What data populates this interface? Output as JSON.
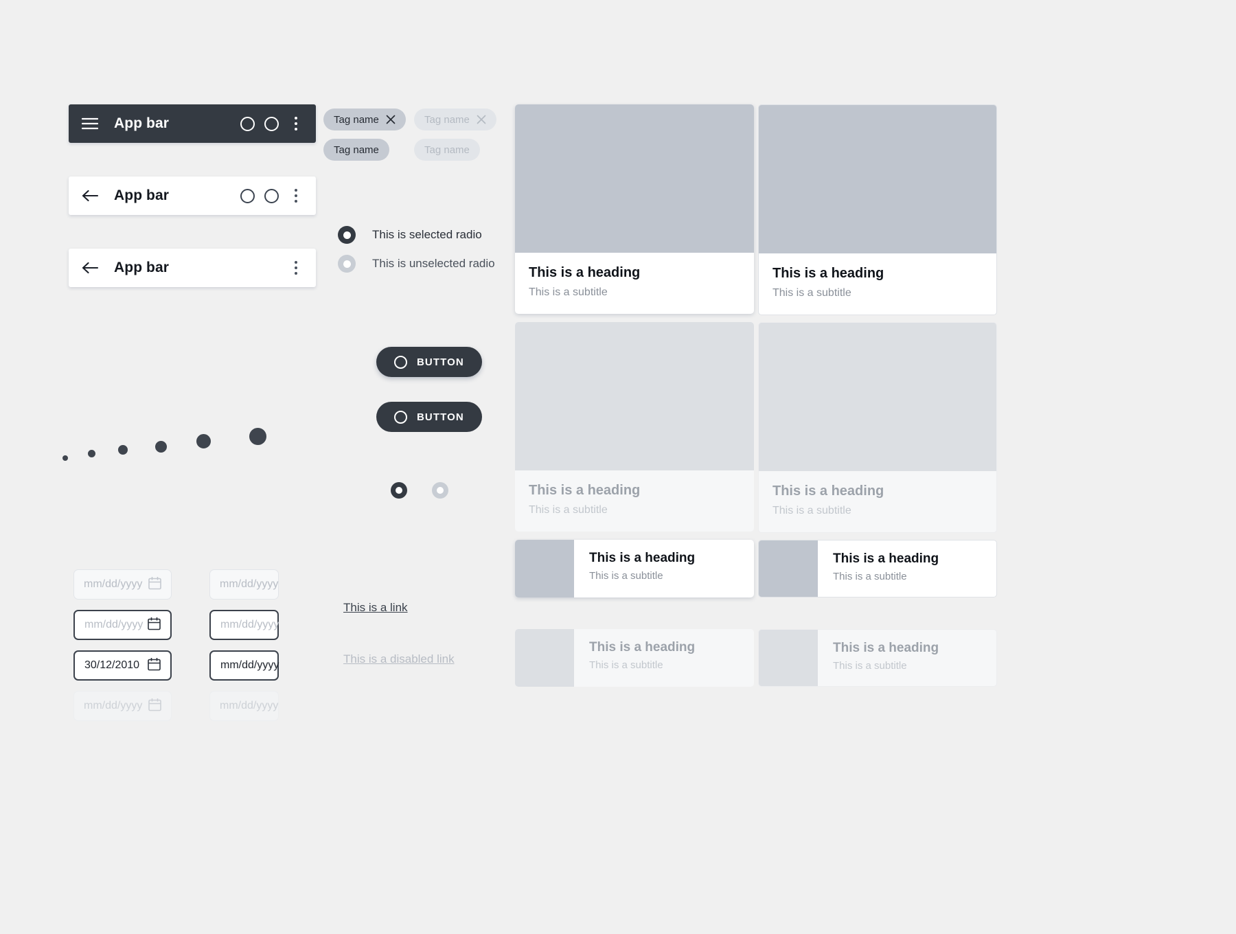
{
  "appbars": [
    {
      "title": "App bar",
      "leading_icon": "hamburger-icon",
      "style": "dark",
      "actions": [
        "circle-icon",
        "circle-icon",
        "kebab-menu-icon"
      ]
    },
    {
      "title": "App bar",
      "leading_icon": "back-arrow-icon",
      "style": "light",
      "actions": [
        "circle-icon",
        "circle-icon",
        "kebab-menu-icon"
      ]
    },
    {
      "title": "App bar",
      "leading_icon": "back-arrow-icon",
      "style": "light",
      "actions": [
        "kebab-menu-icon"
      ]
    }
  ],
  "tags": [
    {
      "label": "Tag name",
      "state": "enabled",
      "dismissible": true
    },
    {
      "label": "Tag name",
      "state": "disabled",
      "dismissible": true
    },
    {
      "label": "Tag name",
      "state": "enabled",
      "dismissible": false
    },
    {
      "label": "Tag name",
      "state": "disabled",
      "dismissible": false
    }
  ],
  "radios": [
    {
      "label": "This is selected radio",
      "selected": true
    },
    {
      "label": "This is unselected radio",
      "selected": false
    }
  ],
  "buttons": [
    {
      "label": "BUTTON",
      "variant": "raised",
      "icon": "circle-icon"
    },
    {
      "label": "BUTTON",
      "variant": "flat",
      "icon": "circle-icon"
    }
  ],
  "page_dots": [
    {
      "active": true
    },
    {
      "active": false
    }
  ],
  "avatars": {
    "sizes": [
      24,
      32,
      40,
      48,
      60,
      72
    ],
    "badge_sizes": [
      8,
      11,
      14,
      17,
      21,
      25
    ]
  },
  "date_fields": {
    "placeholder": "mm/dd/yyyy",
    "left_column": [
      {
        "value": "",
        "state": "rest",
        "has_icon": true
      },
      {
        "value": "",
        "state": "active",
        "has_icon": true
      },
      {
        "value": "30/12/2010",
        "state": "filled",
        "has_icon": true
      },
      {
        "value": "",
        "state": "disabled",
        "has_icon": true
      }
    ],
    "right_column": [
      {
        "value": "",
        "state": "rest",
        "has_icon": false
      },
      {
        "value": "",
        "state": "active",
        "has_icon": false
      },
      {
        "value": "",
        "state": "filled-empty",
        "has_icon": false
      },
      {
        "value": "",
        "state": "disabled",
        "has_icon": false
      }
    ]
  },
  "links": [
    {
      "label": "This is a link",
      "disabled": false
    },
    {
      "label": "This is a disabled link",
      "disabled": true
    }
  ],
  "cards": {
    "heading": "This is a heading",
    "subtitle": "This is a subtitle",
    "column_left": [
      {
        "type": "media-card",
        "style": "elevated",
        "state": "enabled"
      },
      {
        "type": "media-card",
        "style": "elevated",
        "state": "disabled"
      },
      {
        "type": "horizontal-card",
        "style": "elevated",
        "state": "enabled"
      },
      {
        "type": "horizontal-card",
        "style": "elevated",
        "state": "disabled"
      }
    ],
    "column_right": [
      {
        "type": "media-card",
        "style": "outlined",
        "state": "enabled"
      },
      {
        "type": "media-card",
        "style": "outlined",
        "state": "disabled"
      },
      {
        "type": "horizontal-card",
        "style": "outlined",
        "state": "enabled"
      },
      {
        "type": "horizontal-card",
        "style": "outlined",
        "state": "disabled"
      }
    ]
  },
  "colors": {
    "background": "#f0f0f0",
    "dark": "#343a42",
    "media_gray": "#bfc5ce",
    "muted_text": "#8a9099"
  }
}
